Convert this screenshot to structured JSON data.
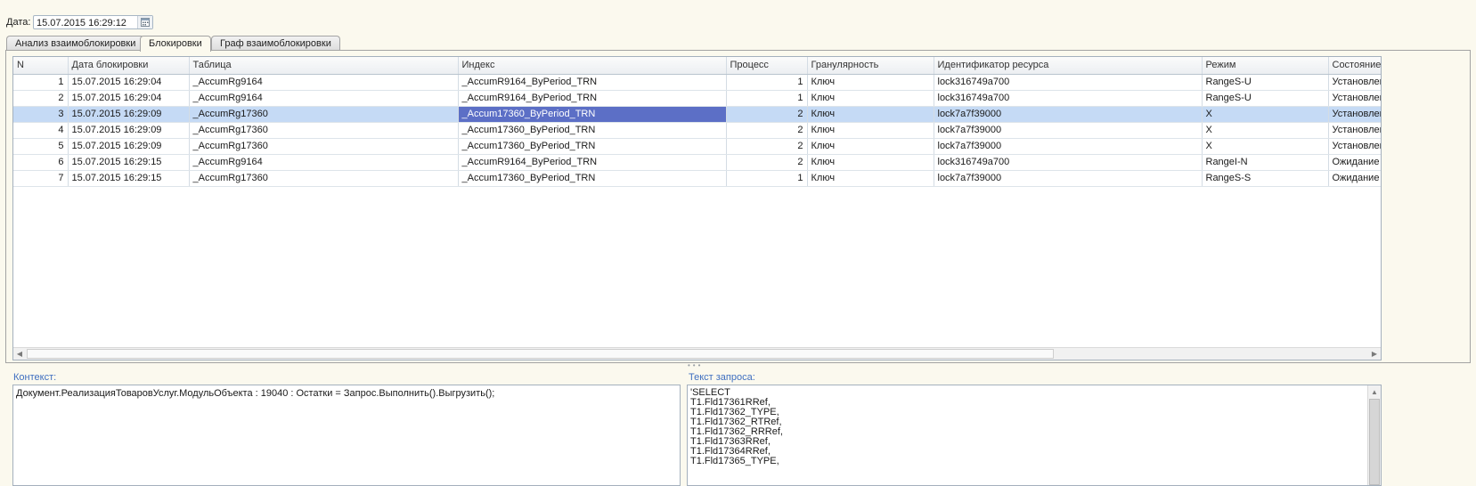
{
  "date": {
    "label": "Дата:",
    "value": "15.07.2015 16:29:12"
  },
  "tabs": [
    {
      "label": "Анализ взаимоблокировки",
      "active": false
    },
    {
      "label": "Блокировки",
      "active": true
    },
    {
      "label": "Граф взаимоблокировки",
      "active": false
    }
  ],
  "table": {
    "columns": [
      "N",
      "Дата блокировки",
      "Таблица",
      "Индекс",
      "Процесс",
      "Гранулярность",
      "Идентификатор ресурса",
      "Режим",
      "Состояние"
    ],
    "rows": [
      [
        "1",
        "15.07.2015 16:29:04",
        "_AccumRg9164",
        "_AccumR9164_ByPeriod_TRN",
        "1",
        "Ключ",
        "lock316749a700",
        "RangeS-U",
        "Установлена"
      ],
      [
        "2",
        "15.07.2015 16:29:04",
        "_AccumRg9164",
        "_AccumR9164_ByPeriod_TRN",
        "1",
        "Ключ",
        "lock316749a700",
        "RangeS-U",
        "Установлена"
      ],
      [
        "3",
        "15.07.2015 16:29:09",
        "_AccumRg17360",
        "_Accum17360_ByPeriod_TRN",
        "2",
        "Ключ",
        "lock7a7f39000",
        "X",
        "Установлена"
      ],
      [
        "4",
        "15.07.2015 16:29:09",
        "_AccumRg17360",
        "_Accum17360_ByPeriod_TRN",
        "2",
        "Ключ",
        "lock7a7f39000",
        "X",
        "Установлена"
      ],
      [
        "5",
        "15.07.2015 16:29:09",
        "_AccumRg17360",
        "_Accum17360_ByPeriod_TRN",
        "2",
        "Ключ",
        "lock7a7f39000",
        "X",
        "Установлена"
      ],
      [
        "6",
        "15.07.2015 16:29:15",
        "_AccumRg9164",
        "_AccumR9164_ByPeriod_TRN",
        "2",
        "Ключ",
        "lock316749a700",
        "RangeI-N",
        "Ожидание"
      ],
      [
        "7",
        "15.07.2015 16:29:15",
        "_AccumRg17360",
        "_Accum17360_ByPeriod_TRN",
        "1",
        "Ключ",
        "lock7a7f39000",
        "RangeS-S",
        "Ожидание"
      ]
    ],
    "selected_row": 3,
    "selected_column": "Индекс"
  },
  "context": {
    "label": "Контекст:",
    "text": "Документ.РеализацияТоваровУслуг.МодульОбъекта : 19040 : Остатки = Запрос.Выполнить().Выгрузить();"
  },
  "query": {
    "label": "Текст запроса:",
    "lines": [
      "'SELECT",
      "T1.Fld17361RRef,",
      "T1.Fld17362_TYPE,",
      "T1.Fld17362_RTRef,",
      "T1.Fld17362_RRRef,",
      "T1.Fld17363RRef,",
      "T1.Fld17364RRef,",
      "T1.Fld17365_TYPE,"
    ]
  },
  "icons": {
    "date_picker": "calendar-icon",
    "scroll_left": "arrow-left-icon",
    "scroll_right": "arrow-right-icon",
    "scroll_up": "arrow-up-icon"
  },
  "colors": {
    "background": "#fbf9ee",
    "selection_row": "#c5daf5",
    "selection_cell": "#5c6fc6",
    "label_blue": "#3f6fc0"
  }
}
